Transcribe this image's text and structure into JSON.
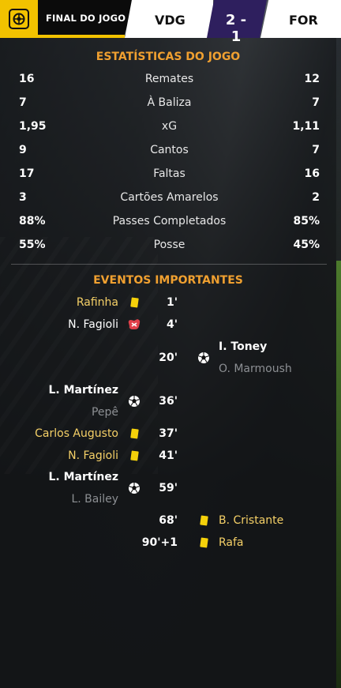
{
  "header": {
    "status": "FINAL DO JOGO",
    "home_team": "VDG",
    "score": "2 - 1",
    "away_team": "FOR",
    "competition_icon": "competition-logo-icon"
  },
  "colors": {
    "accent_yellow": "#f2c200",
    "section_title": "#f0a030",
    "score_bg": "#2e1f5e",
    "card_yellow": "#f5d10a",
    "text_grey": "#8c8f93"
  },
  "stats": {
    "title": "ESTATÍSTICAS DO JOGO",
    "rows": [
      {
        "home": "16",
        "label": "Remates",
        "away": "12"
      },
      {
        "home": "7",
        "label": "À Baliza",
        "away": "7"
      },
      {
        "home": "1,95",
        "label": "xG",
        "away": "1,11"
      },
      {
        "home": "9",
        "label": "Cantos",
        "away": "7"
      },
      {
        "home": "17",
        "label": "Faltas",
        "away": "16"
      },
      {
        "home": "3",
        "label": "Cartões Amarelos",
        "away": "2"
      },
      {
        "home": "88%",
        "label": "Passes Completados",
        "away": "85%"
      },
      {
        "home": "55%",
        "label": "Posse",
        "away": "45%"
      }
    ]
  },
  "events": {
    "title": "EVENTOS IMPORTANTES",
    "items": [
      {
        "side": "home",
        "type": "yellow-card",
        "minute": "1'",
        "player": "Rafinha"
      },
      {
        "side": "home",
        "type": "injury",
        "minute": "4'",
        "player": "N. Fagioli"
      },
      {
        "side": "away",
        "type": "goal",
        "minute": "20'",
        "player": "I. Toney",
        "assist": "O. Marmoush"
      },
      {
        "side": "home",
        "type": "goal",
        "minute": "36'",
        "player": "L. Martínez",
        "assist": "Pepê"
      },
      {
        "side": "home",
        "type": "yellow-card",
        "minute": "37'",
        "player": "Carlos Augusto"
      },
      {
        "side": "home",
        "type": "yellow-card",
        "minute": "41'",
        "player": "N. Fagioli"
      },
      {
        "side": "home",
        "type": "goal",
        "minute": "59'",
        "player": "L. Martínez",
        "assist": "L. Bailey"
      },
      {
        "side": "away",
        "type": "yellow-card",
        "minute": "68'",
        "player": "B. Cristante"
      },
      {
        "side": "away",
        "type": "yellow-card",
        "minute": "90'+1",
        "player": "Rafa"
      }
    ]
  }
}
